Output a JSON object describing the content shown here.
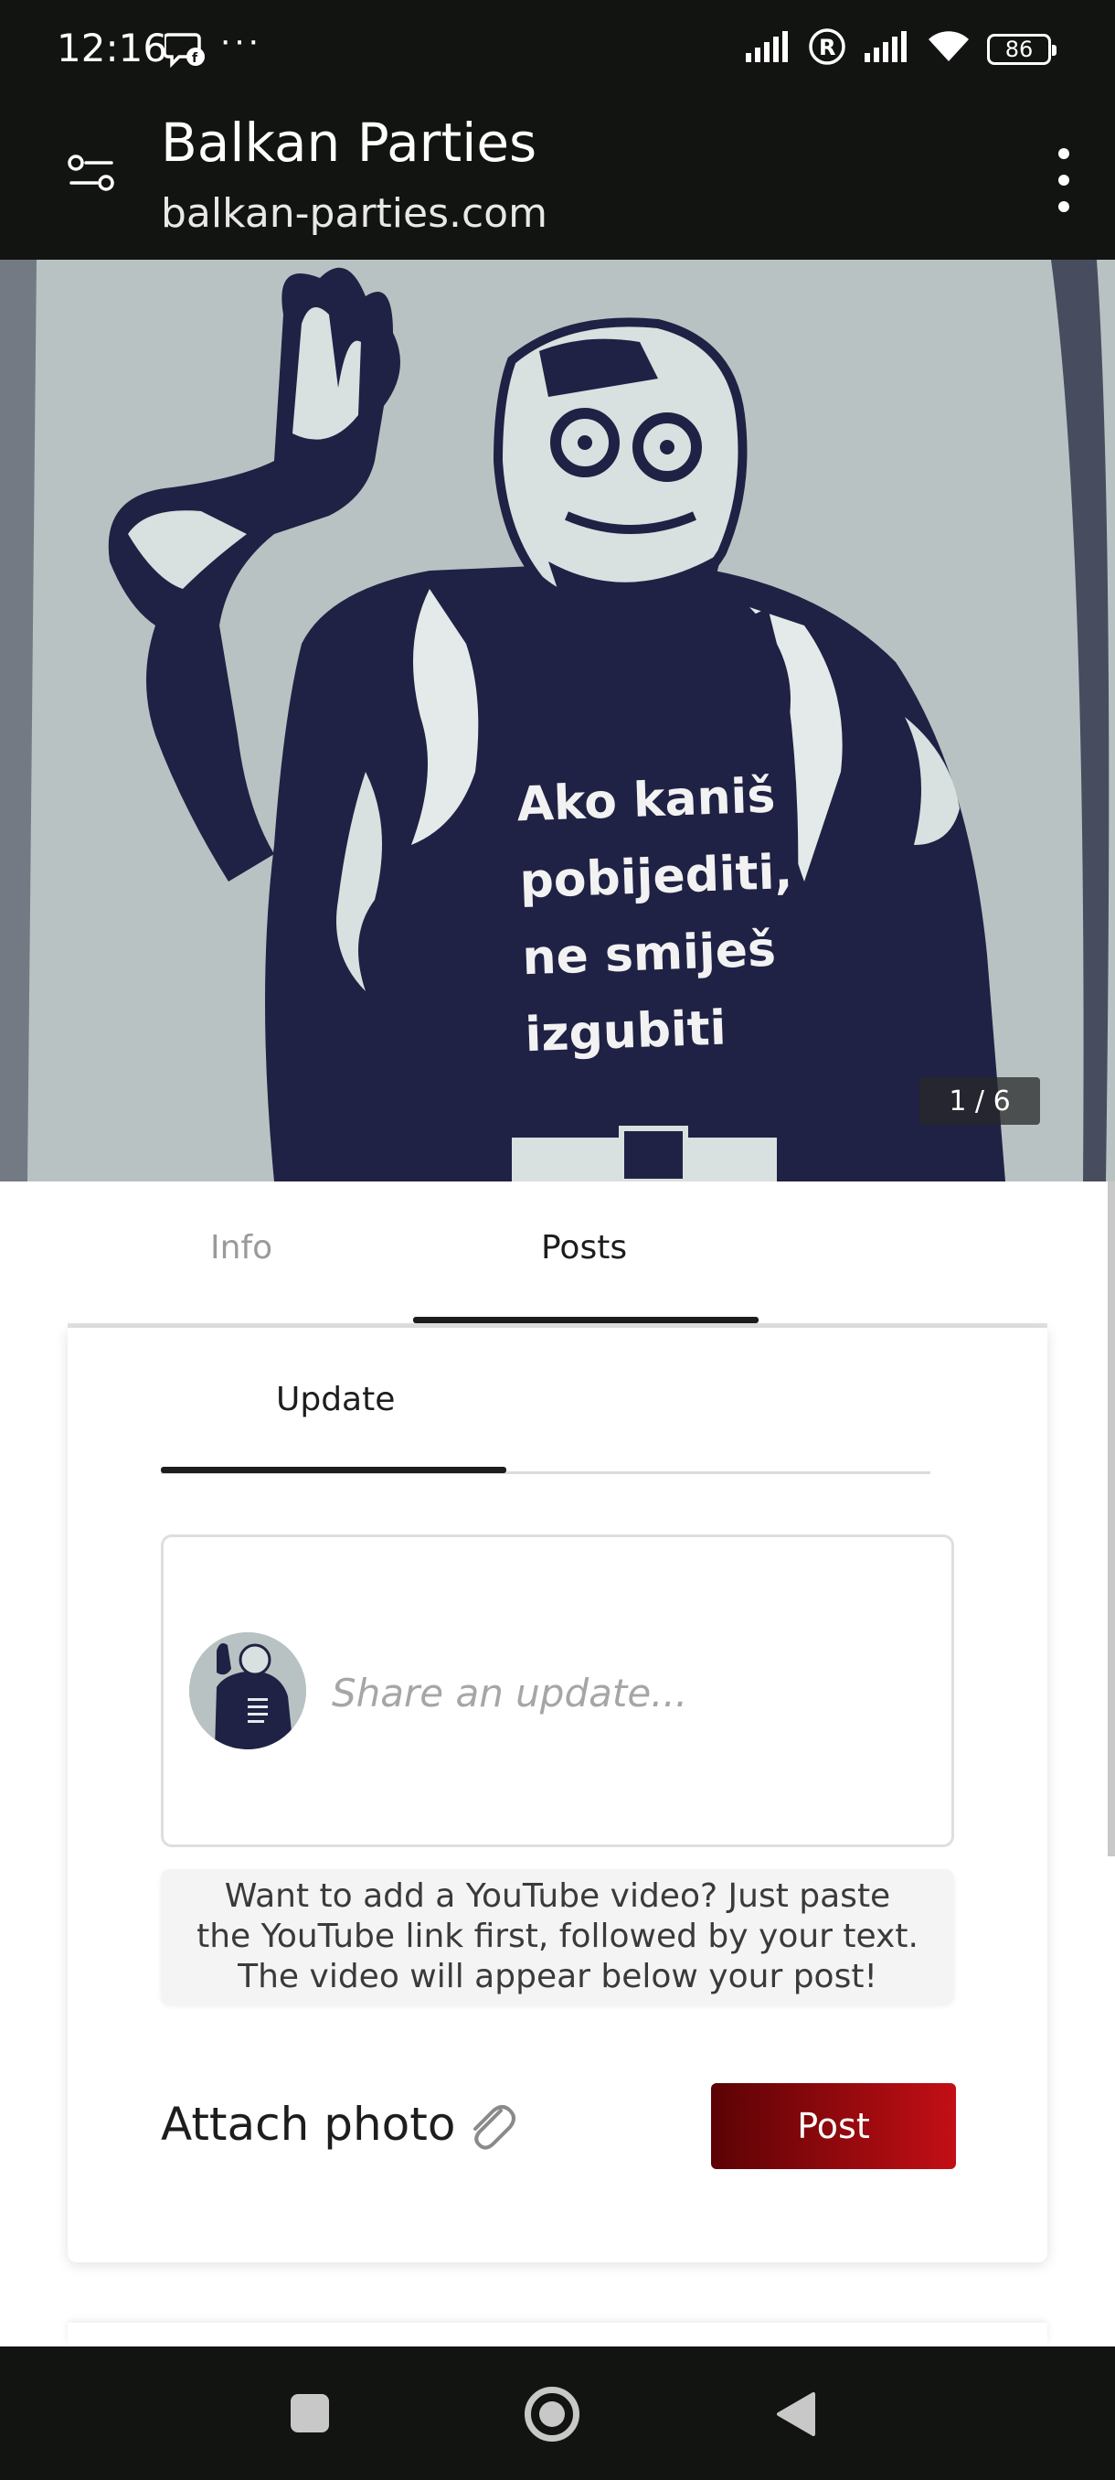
{
  "status_bar": {
    "time": "12:16",
    "overflow": "···",
    "battery": "86",
    "roaming": "R",
    "icons": [
      "messenger-icon",
      "signal-icon",
      "roaming-icon",
      "signal-icon",
      "wifi-icon",
      "battery-icon"
    ]
  },
  "header": {
    "title": "Balkan Parties",
    "url": "balkan-parties.com",
    "icons": [
      "tune-icon",
      "more-vert-icon"
    ]
  },
  "hero": {
    "caption_lines": [
      "Ako kaniš",
      "pobijediti,",
      "ne smiješ",
      "izgubiti"
    ],
    "counter": "1 / 6"
  },
  "tabs": {
    "info": "Info",
    "posts": "Posts",
    "active": "Posts"
  },
  "composer": {
    "subtab": "Update",
    "placeholder": "Share an update...",
    "hint": "Want to add a YouTube video? Just paste the YouTube link first, followed by your text. The video will appear below your post!",
    "attach_label": "Attach photo",
    "post_label": "Post"
  },
  "colors": {
    "bar_background": "#121411",
    "post_gradient_start": "#5b0205",
    "post_gradient_end": "#c30f15",
    "poster_ink": "#1f2244",
    "poster_paper": "#b9c2c3"
  }
}
